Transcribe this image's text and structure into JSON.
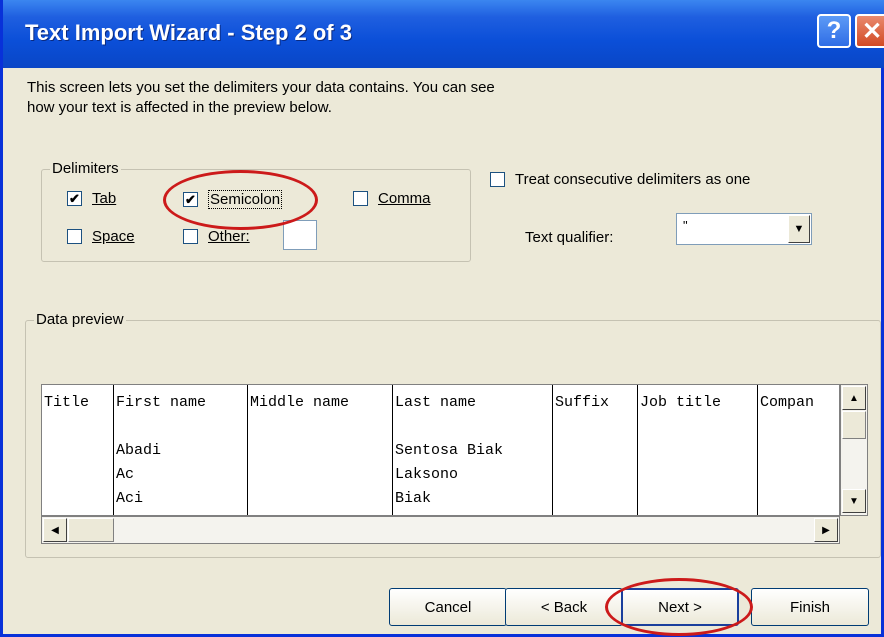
{
  "window": {
    "title": "Text Import Wizard - Step 2 of 3",
    "help_glyph": "?",
    "close_glyph": "✕"
  },
  "intro": {
    "line1": "This screen lets you set the delimiters your data contains.  You can see",
    "line2": "how your text is affected in the preview below."
  },
  "delimiters": {
    "legend": "Delimiters",
    "options": [
      {
        "label": "Tab",
        "checked": true
      },
      {
        "label": "Semicolon",
        "checked": true
      },
      {
        "label": "Comma",
        "checked": false
      },
      {
        "label": "Space",
        "checked": false
      },
      {
        "label": "Other:",
        "checked": false
      }
    ],
    "other_value": ""
  },
  "consecutive": {
    "label": "Treat consecutive delimiters as one",
    "checked": false
  },
  "qualifier": {
    "label": "Text qualifier:",
    "value": "\""
  },
  "preview": {
    "legend": "Data preview",
    "columns": [
      {
        "header": "Title",
        "values": []
      },
      {
        "header": "First name",
        "values": [
          "Abadi",
          "Ac",
          "Aci"
        ]
      },
      {
        "header": "Middle name",
        "values": []
      },
      {
        "header": "Last name",
        "values": [
          "Sentosa Biak",
          "Laksono",
          "Biak"
        ]
      },
      {
        "header": "Suffix",
        "values": []
      },
      {
        "header": "Job title",
        "values": []
      },
      {
        "header": "Compan",
        "values": []
      }
    ]
  },
  "buttons": {
    "cancel": "Cancel",
    "back": "< Back",
    "next": "Next >",
    "finish": "Finish"
  },
  "colors": {
    "title_bar": "#0b4fd8",
    "dialog_bg": "#ece9d8",
    "highlight_ellipse": "#cc1a1a"
  }
}
